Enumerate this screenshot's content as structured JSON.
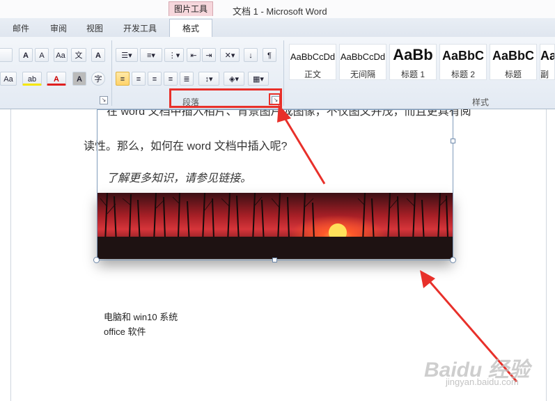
{
  "window": {
    "context_tab": "图片工具",
    "title": "文档 1 - Microsoft Word"
  },
  "tabs": [
    "邮件",
    "审阅",
    "视图",
    "开发工具",
    "格式"
  ],
  "ribbon": {
    "font_buttons": {
      "grow": "A",
      "shrink": "A",
      "change_case": "Aa",
      "phonetic": "文",
      "char_border": "A",
      "highlight": "ab",
      "font_color": "A",
      "char_shading": "A",
      "enclose": "字"
    },
    "paragraph_label": "段落",
    "styles_label": "样式",
    "styles": [
      {
        "sample": "AaBbCcDd",
        "name": "正文"
      },
      {
        "sample": "AaBbCcDd",
        "name": "无间隔"
      },
      {
        "sample": "AaBb",
        "name": "标题 1"
      },
      {
        "sample": "AaBbC",
        "name": "标题 2"
      },
      {
        "sample": "AaBbC",
        "name": "标题"
      },
      {
        "sample": "Aa",
        "name": "副"
      }
    ]
  },
  "document": {
    "line1": "在 word 文档中插入相片、背景图片或图像，不仅图文并茂，而且更具有阅",
    "line2": "读性。那么，如何在 word 文档中插入呢?",
    "line3": "了解更多知识，请参见链接。",
    "list1": "电脑和 win10 系统",
    "list2": "office 软件"
  },
  "watermark": {
    "logo": "Baidu 经验",
    "url": "jingyan.baidu.com"
  },
  "colors": {
    "highlight_box": "#e8302a",
    "context_tab": "#f6d7dc"
  }
}
